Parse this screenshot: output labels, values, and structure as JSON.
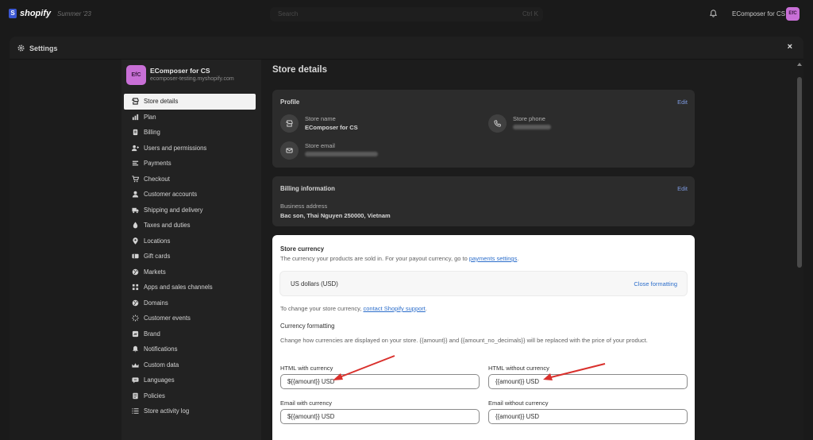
{
  "topbar": {
    "logo_letter": "S",
    "logo_text": "shopify",
    "edition": "Summer '23",
    "search_placeholder": "Search",
    "search_shortcut": "Ctrl K",
    "store_name": "EComposer for CS",
    "avatar_initials": "EfC"
  },
  "modal": {
    "title": "Settings",
    "close_label": "×"
  },
  "sidebar": {
    "store_avatar": "EfC",
    "store_name": "EComposer for CS",
    "store_domain": "ecomposer-testing.myshopify.com",
    "items": [
      {
        "label": "Store details",
        "icon": "store-icon",
        "active": true
      },
      {
        "label": "Plan",
        "icon": "plan-icon"
      },
      {
        "label": "Billing",
        "icon": "billing-icon"
      },
      {
        "label": "Users and permissions",
        "icon": "users-icon"
      },
      {
        "label": "Payments",
        "icon": "payments-icon"
      },
      {
        "label": "Checkout",
        "icon": "cart-icon"
      },
      {
        "label": "Customer accounts",
        "icon": "person-icon"
      },
      {
        "label": "Shipping and delivery",
        "icon": "truck-icon"
      },
      {
        "label": "Taxes and duties",
        "icon": "tax-icon"
      },
      {
        "label": "Locations",
        "icon": "location-icon"
      },
      {
        "label": "Gift cards",
        "icon": "gift-card-icon"
      },
      {
        "label": "Markets",
        "icon": "globe-icon"
      },
      {
        "label": "Apps and sales channels",
        "icon": "apps-icon"
      },
      {
        "label": "Domains",
        "icon": "globe-icon"
      },
      {
        "label": "Customer events",
        "icon": "events-icon"
      },
      {
        "label": "Brand",
        "icon": "brand-icon"
      },
      {
        "label": "Notifications",
        "icon": "bell-icon"
      },
      {
        "label": "Custom data",
        "icon": "custom-data-icon"
      },
      {
        "label": "Languages",
        "icon": "languages-icon"
      },
      {
        "label": "Policies",
        "icon": "policies-icon"
      },
      {
        "label": "Store activity log",
        "icon": "list-icon"
      }
    ]
  },
  "main": {
    "page_title": "Store details",
    "profile": {
      "title": "Profile",
      "edit": "Edit",
      "store_name_label": "Store name",
      "store_name_value": "EComposer for CS",
      "store_phone_label": "Store phone",
      "store_email_label": "Store email"
    },
    "billing": {
      "title": "Billing information",
      "edit": "Edit",
      "address_label": "Business address",
      "address_value": "Bac son, Thai Nguyen 250000, Vietnam"
    },
    "currency": {
      "title": "Store currency",
      "desc_prefix": "The currency your products are sold in. For your payout currency, go to ",
      "desc_link": "payments settings",
      "desc_suffix": ".",
      "selected": "US dollars (USD)",
      "close_formatting": "Close formatting",
      "change_prefix": "To change your store currency, ",
      "change_link": "contact Shopify support",
      "change_suffix": ".",
      "formatting_title": "Currency formatting",
      "formatting_help": "Change how currencies are displayed on your store. {{amount}} and {{amount_no_decimals}} will be replaced with the price of your product.",
      "fields": [
        {
          "label": "HTML with currency",
          "value": "${{amount}} USD"
        },
        {
          "label": "HTML without currency",
          "value": "{{amount}} USD"
        },
        {
          "label": "Email with currency",
          "value": "${{amount}} USD"
        },
        {
          "label": "Email without currency",
          "value": "{{amount}} USD"
        }
      ]
    }
  },
  "colors": {
    "accent_link": "#2c6ecb",
    "annotation_arrow": "#d9302c",
    "avatar": "#c86fd6"
  }
}
